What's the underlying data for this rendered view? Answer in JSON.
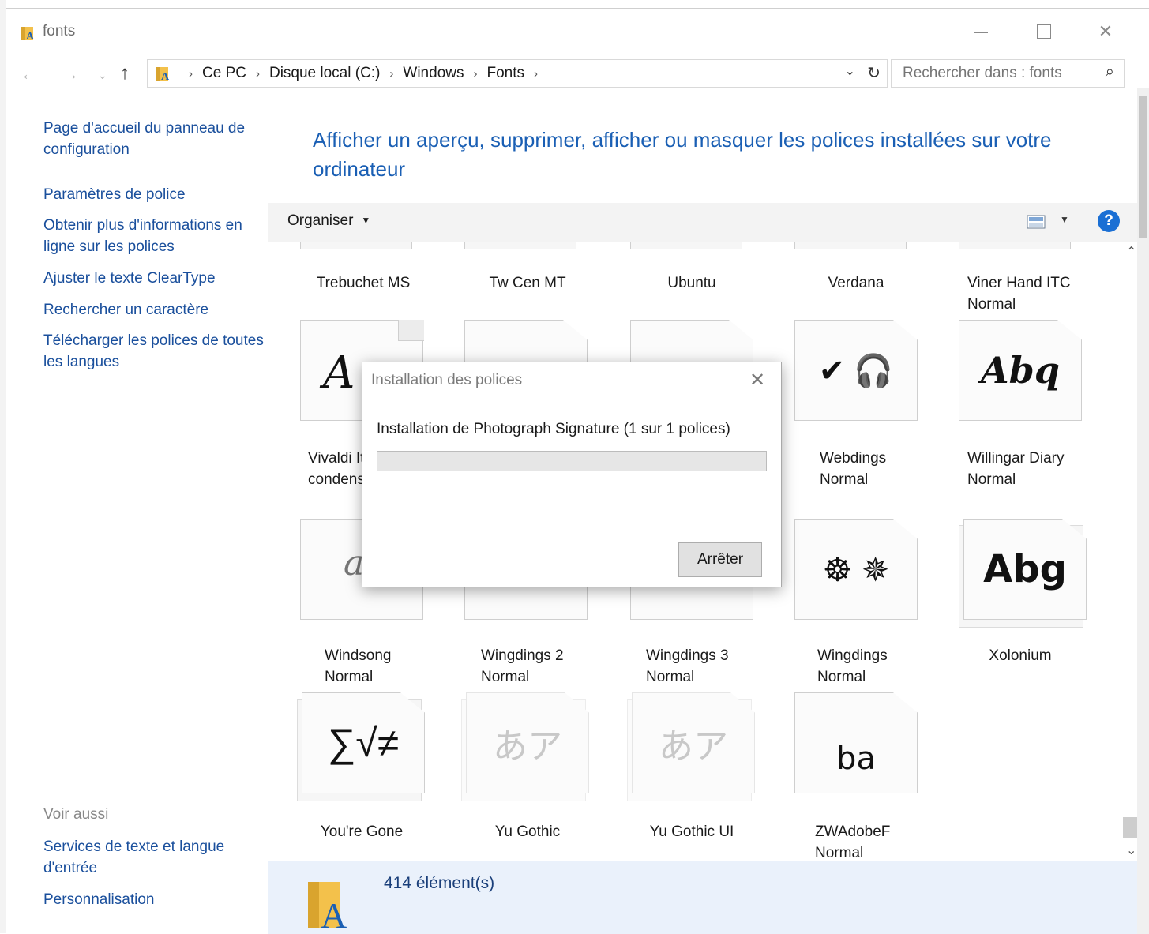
{
  "window": {
    "title": "fonts",
    "minimize_icon": "minimize-icon",
    "maximize_icon": "maximize-icon",
    "close_icon": "close-icon"
  },
  "navigation": {
    "back_icon": "back-arrow-icon",
    "forward_icon": "forward-arrow-icon",
    "recent_icon": "chevron-down-icon",
    "up_icon": "up-arrow-icon",
    "breadcrumbs": [
      "Ce PC",
      "Disque local (C:)",
      "Windows",
      "Fonts"
    ],
    "search_placeholder": "Rechercher dans : fonts"
  },
  "sidebar": {
    "links": [
      "Page d'accueil du panneau de configuration",
      "Paramètres de police",
      "Obtenir plus d'informations en ligne sur les polices",
      "Ajuster le texte ClearType",
      "Rechercher un caractère",
      "Télécharger les polices de toutes les langues"
    ],
    "see_also_title": "Voir aussi",
    "see_also_links": [
      "Services de texte et langue d'entrée",
      "Personnalisation"
    ]
  },
  "main": {
    "title": "Afficher un aperçu, supprimer, afficher ou masquer les polices installées sur votre ordinateur",
    "toolbar": {
      "organize_label": "Organiser",
      "help_label": "?"
    },
    "fonts_row1": [
      {
        "name": "Trebuchet MS"
      },
      {
        "name": "Tw Cen MT"
      },
      {
        "name": "Ubuntu"
      },
      {
        "name": "Verdana"
      },
      {
        "name": "Viner Hand ITC",
        "style": "Normal"
      }
    ],
    "fonts_row2": [
      {
        "name": "Vivaldi It",
        "style": "condens",
        "sample": "A"
      },
      {
        "name": "",
        "sample": ""
      },
      {
        "name": "",
        "sample": ""
      },
      {
        "name": "Webdings",
        "style": "Normal",
        "sample": "✔ 🎧"
      },
      {
        "name": "Willingar Diary",
        "style": "Normal",
        "sample": "Abq"
      }
    ],
    "fonts_row3": [
      {
        "name": "Windsong",
        "style": "Normal",
        "sample": "a"
      },
      {
        "name": "Wingdings 2",
        "style": "Normal",
        "sample": ""
      },
      {
        "name": "Wingdings 3",
        "style": "Normal",
        "sample": ""
      },
      {
        "name": "Wingdings",
        "style": "Normal",
        "sample": "☸ ✵"
      },
      {
        "name": "Xolonium",
        "sample": "Abg"
      }
    ],
    "fonts_row4": [
      {
        "name": "You're Gone",
        "sample": "∑√≠"
      },
      {
        "name": "Yu Gothic",
        "sample": "あア"
      },
      {
        "name": "Yu Gothic UI",
        "sample": "あア"
      },
      {
        "name": "ZWAdobeF",
        "style": "Normal",
        "sample": "ba"
      }
    ],
    "status": {
      "count": "414 élément(s)"
    }
  },
  "dialog": {
    "title": "Installation des polices",
    "message": "Installation de Photograph Signature (1 sur 1 polices)",
    "progress": 0,
    "stop_label": "Arrêter"
  },
  "colors": {
    "link": "#1a4f9c",
    "title": "#1a5fb4",
    "help": "#1a6fd4",
    "details_bg": "#eaf1fb"
  }
}
